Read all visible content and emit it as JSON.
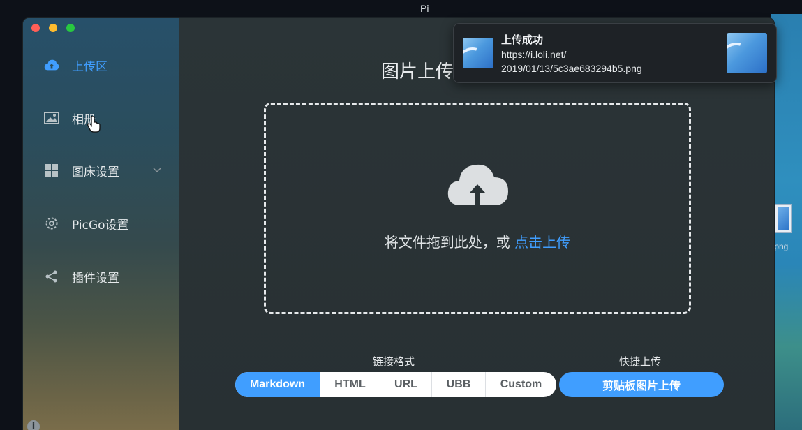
{
  "desktop": {
    "file_label": ".png"
  },
  "window": {
    "title": "Pi"
  },
  "sidebar": {
    "items": [
      {
        "label": "上传区",
        "icon": "cloud-upload-icon",
        "active": true
      },
      {
        "label": "相册",
        "icon": "image-icon"
      },
      {
        "label": "图床设置",
        "icon": "grid-icon",
        "has_submenu": true
      },
      {
        "label": "PicGo设置",
        "icon": "gear-icon"
      },
      {
        "label": "插件设置",
        "icon": "share-icon"
      }
    ],
    "info_glyph": "i"
  },
  "main": {
    "title": "图片上传",
    "drop_text": "将文件拖到此处，或 ",
    "drop_link": "点击上传",
    "link_format_label": "链接格式",
    "formats": [
      "Markdown",
      "HTML",
      "URL",
      "UBB",
      "Custom"
    ],
    "selected_format": "Markdown",
    "quick_upload_label": "快捷上传",
    "clipboard_button": "剪贴板图片上传"
  },
  "notification": {
    "title": "上传成功",
    "line1": "https://i.loli.net/",
    "line2": "2019/01/13/5c3ae683294b5.png"
  },
  "colors": {
    "accent": "#409eff"
  }
}
